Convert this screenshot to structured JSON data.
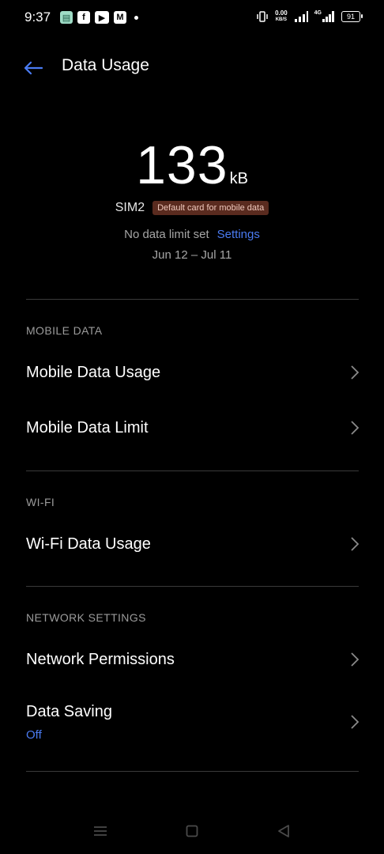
{
  "status_bar": {
    "time": "9:37",
    "speed_value": "0.00",
    "speed_unit": "KB/S",
    "network_type": "4G",
    "battery": "91"
  },
  "header": {
    "title": "Data Usage"
  },
  "usage": {
    "value": "133",
    "unit": "kB",
    "sim_label": "SIM2",
    "sim_badge": "Default card for mobile data",
    "limit_text": "No data limit set",
    "settings_link": "Settings",
    "date_range": "Jun 12 – Jul 11"
  },
  "sections": {
    "mobile_data": {
      "label": "MOBILE DATA",
      "items": [
        "Mobile Data Usage",
        "Mobile Data Limit"
      ]
    },
    "wifi": {
      "label": "WI-FI",
      "items": [
        "Wi-Fi Data Usage"
      ]
    },
    "network_settings": {
      "label": "NETWORK SETTINGS",
      "items": [
        "Network Permissions",
        "Data Saving"
      ],
      "data_saving_status": "Off"
    }
  },
  "colors": {
    "accent": "#4a7bf2",
    "badge_bg": "#5a2b1f",
    "background": "#000000"
  }
}
